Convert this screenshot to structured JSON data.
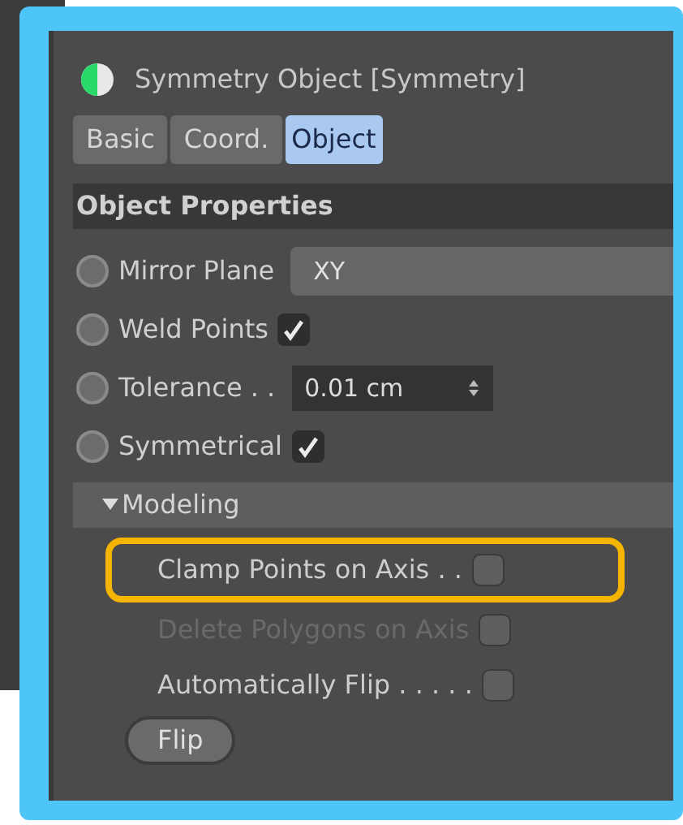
{
  "window": {
    "title": "Symmetry Object [Symmetry]"
  },
  "tabs": [
    {
      "label": "Basic",
      "selected": false
    },
    {
      "label": "Coord.",
      "selected": false
    },
    {
      "label": "Object",
      "selected": true
    }
  ],
  "section": {
    "title": "Object Properties"
  },
  "properties": [
    {
      "kind": "dropdown",
      "label": "Mirror Plane",
      "value": "XY"
    },
    {
      "kind": "checkbox",
      "label": "Weld Points",
      "checked": true
    },
    {
      "kind": "number",
      "label": "Tolerance . .",
      "value": "0.01 cm"
    },
    {
      "kind": "checkbox",
      "label": "Symmetrical",
      "checked": true
    }
  ],
  "group": {
    "title": "Modeling",
    "expanded": true,
    "items": [
      {
        "label": "Clamp Points on Axis . .",
        "checked": false,
        "disabled": false,
        "highlighted": true
      },
      {
        "label": "Delete Polygons on Axis",
        "checked": false,
        "disabled": true,
        "highlighted": false
      },
      {
        "label": "Automatically Flip . . . . .",
        "checked": false,
        "disabled": false,
        "highlighted": false
      }
    ],
    "button": "Flip"
  }
}
